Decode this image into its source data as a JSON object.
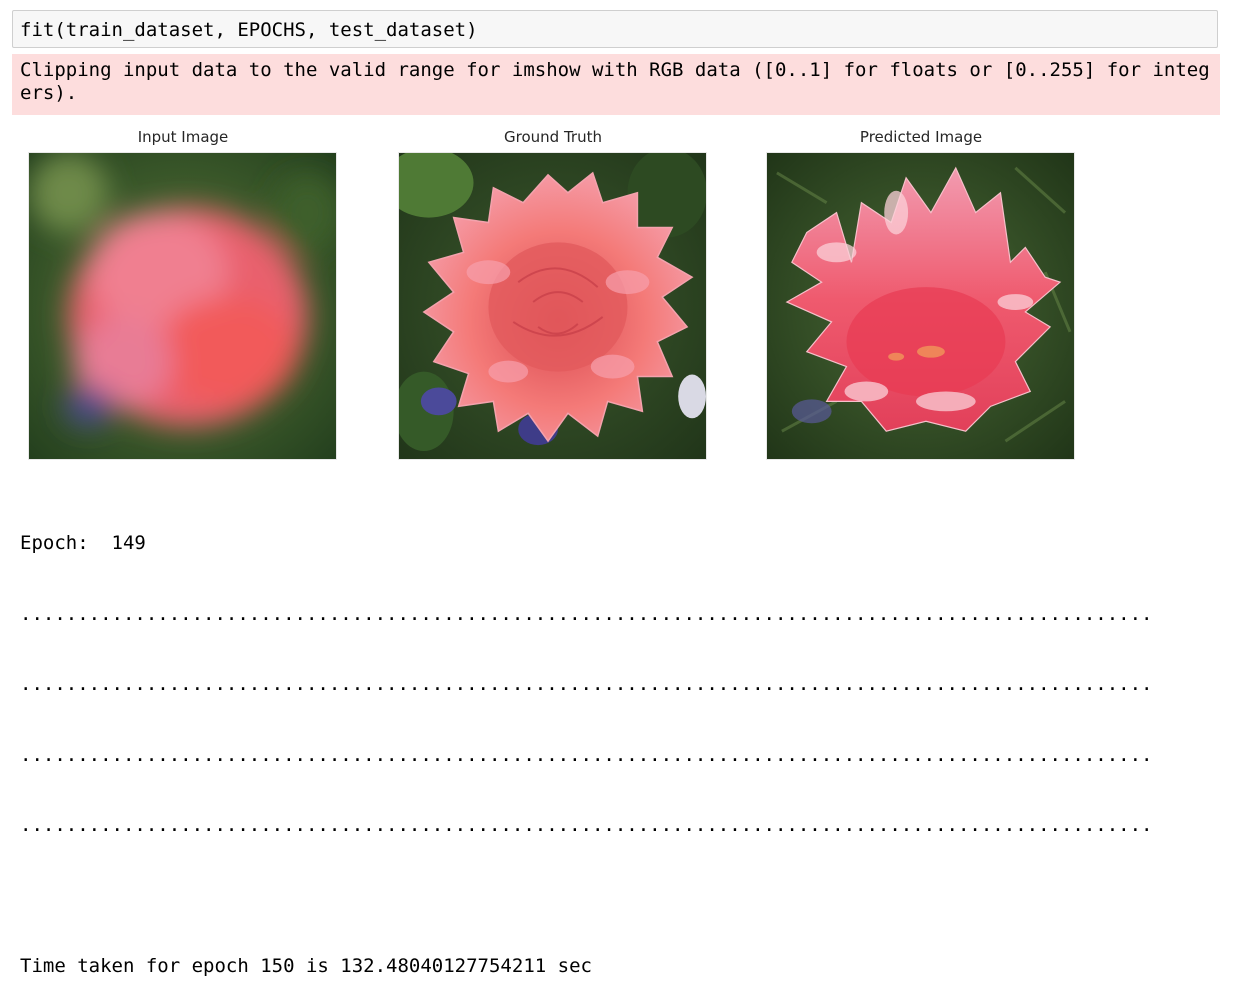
{
  "code_cell": {
    "source": "fit(train_dataset, EPOCHS, test_dataset)"
  },
  "stderr": {
    "text": "Clipping input data to the valid range for imshow with RGB data ([0..1] for floats or [0..255] for integers)."
  },
  "figure": {
    "panels": [
      {
        "title": "Input Image",
        "kind": "blurred-flower"
      },
      {
        "title": "Ground Truth",
        "kind": "sharp-flower"
      },
      {
        "title": "Predicted Image",
        "kind": "predicted-flower"
      }
    ]
  },
  "output": {
    "epoch_line": "Epoch:  149",
    "progress_lines": [
      "...................................................................................................",
      "...................................................................................................",
      "...................................................................................................",
      "..................................................................................................."
    ],
    "time_line": "Time taken for epoch 150 is 132.48040127754211 sec"
  },
  "colors": {
    "code_bg": "#f7f7f7",
    "stderr_bg": "#fddddd",
    "flower_pink": "#f26b73",
    "leaf_green": "#2f4a22"
  }
}
